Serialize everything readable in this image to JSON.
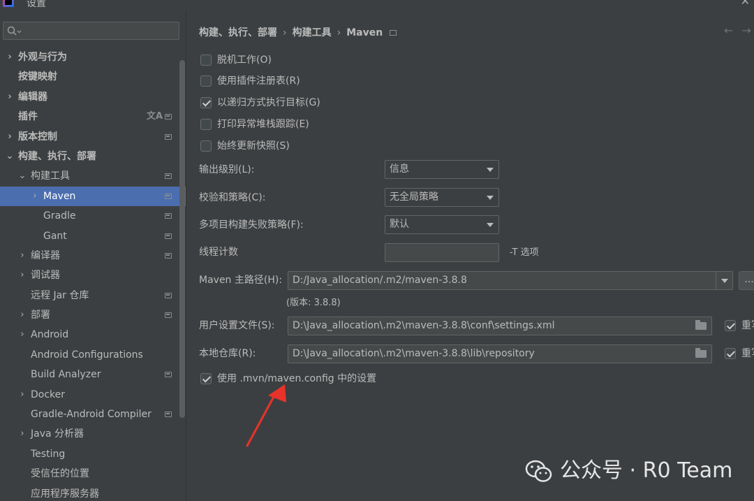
{
  "window": {
    "title": "设置"
  },
  "search": {
    "placeholder": ""
  },
  "sidebar": {
    "items": [
      {
        "label": "外观与行为",
        "expander": "›",
        "bold": true
      },
      {
        "label": "按键映射",
        "expander": "",
        "bold": true
      },
      {
        "label": "编辑器",
        "expander": "›",
        "bold": true
      },
      {
        "label": "插件",
        "expander": "",
        "bold": true
      },
      {
        "label": "版本控制",
        "expander": "›",
        "bold": true
      },
      {
        "label": "构建、执行、部署",
        "expander": "⌄",
        "bold": true
      },
      {
        "label": "构建工具",
        "expander": "⌄",
        "bold": false
      },
      {
        "label": "Maven",
        "expander": "›",
        "bold": false
      },
      {
        "label": "Gradle",
        "expander": "",
        "bold": false
      },
      {
        "label": "Gant",
        "expander": "",
        "bold": false
      },
      {
        "label": "编译器",
        "expander": "›",
        "bold": false
      },
      {
        "label": "调试器",
        "expander": "›",
        "bold": false
      },
      {
        "label": "远程 Jar 仓库",
        "expander": "",
        "bold": false
      },
      {
        "label": "部署",
        "expander": "›",
        "bold": false
      },
      {
        "label": "Android",
        "expander": "›",
        "bold": false
      },
      {
        "label": "Android Configurations",
        "expander": "",
        "bold": false
      },
      {
        "label": "Build Analyzer",
        "expander": "",
        "bold": false
      },
      {
        "label": "Docker",
        "expander": "›",
        "bold": false
      },
      {
        "label": "Gradle-Android Compiler",
        "expander": "",
        "bold": false
      },
      {
        "label": "Java 分析器",
        "expander": "›",
        "bold": false
      },
      {
        "label": "Testing",
        "expander": "",
        "bold": false
      },
      {
        "label": "受信任的位置",
        "expander": "",
        "bold": false
      },
      {
        "label": "应用程序服务器",
        "expander": "",
        "bold": false
      }
    ],
    "selected": "Maven"
  },
  "breadcrumb": {
    "part1": "构建、执行、部署",
    "part2": "构建工具",
    "part3": "Maven",
    "sep": "›"
  },
  "checkboxes": [
    {
      "label": "脱机工作(O)",
      "checked": false
    },
    {
      "label": "使用插件注册表(R)",
      "checked": false
    },
    {
      "label": "以递归方式执行目标(G)",
      "checked": true
    },
    {
      "label": "打印异常堆栈跟踪(E)",
      "checked": false
    },
    {
      "label": "始终更新快照(S)",
      "checked": false
    }
  ],
  "fields": {
    "output_level": {
      "label": "输出级别(L):",
      "value": "信息"
    },
    "checksum_policy": {
      "label": "校验和策略(C):",
      "value": "无全局策略"
    },
    "multiproject_fail": {
      "label": "多项目构建失败策略(F):",
      "value": "默认"
    },
    "thread_count": {
      "label": "线程计数",
      "value": "",
      "note": "-T 选项"
    },
    "maven_home": {
      "label": "Maven 主路径(H):",
      "value": "D:/Java_allocation/.m2/maven-3.8.8",
      "browse": "..."
    },
    "version": "(版本: 3.8.8)",
    "user_settings": {
      "label": "用户设置文件(S):",
      "value": "D:\\Java_allocation\\.m2\\maven-3.8.8\\conf\\settings.xml",
      "override": "重写"
    },
    "local_repo": {
      "label": "本地仓库(R):",
      "value": "D:\\Java_allocation\\.m2\\maven-3.8.8\\lib\\repository",
      "override": "重写"
    },
    "use_mvn_config": {
      "label": "使用 .mvn/maven.config 中的设置",
      "checked": true
    }
  },
  "watermark": {
    "text": "公众号 · R0 Team"
  },
  "colors": {
    "background": "#3c3f41",
    "selection": "#4b6eaf",
    "annotation_arrow": "#e8332a"
  },
  "icons": [
    "app-icon",
    "search-icon",
    "close-icon",
    "translate-icon",
    "project-level-icon",
    "back-arrow-icon",
    "forward-arrow-icon",
    "dropdown-arrow-icon",
    "folder-icon",
    "wechat-icon"
  ]
}
